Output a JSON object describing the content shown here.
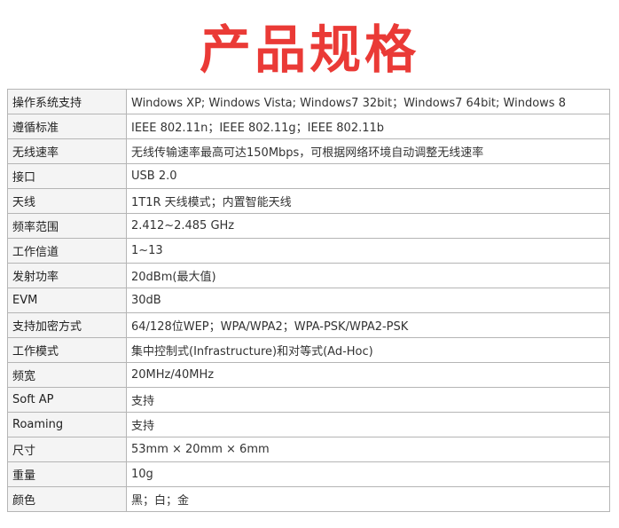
{
  "title": "产品规格",
  "colors": {
    "title": "#ea3a36",
    "border": "#b5b5b5",
    "label_bg": "#f4f4f4"
  },
  "specs": [
    {
      "label": "操作系统支持",
      "value": "Windows XP; Windows Vista; Windows7 32bit；Windows7 64bit; Windows 8"
    },
    {
      "label": "遵循标准",
      "value": "IEEE 802.11n；IEEE 802.11g；IEEE 802.11b"
    },
    {
      "label": "无线速率",
      "value": "无线传输速率最高可达150Mbps，可根据网络环境自动调整无线速率"
    },
    {
      "label": "接口",
      "value": "USB 2.0"
    },
    {
      "label": "天线",
      "value": "1T1R 天线模式；内置智能天线"
    },
    {
      "label": "频率范围",
      "value": "2.412~2.485 GHz"
    },
    {
      "label": "工作信道",
      "value": "1~13"
    },
    {
      "label": "发射功率",
      "value": "20dBm(最大值)"
    },
    {
      "label": "EVM",
      "value": "30dB"
    },
    {
      "label": "支持加密方式",
      "value": "64/128位WEP；WPA/WPA2；WPA-PSK/WPA2-PSK"
    },
    {
      "label": "工作模式",
      "value": "集中控制式(Infrastructure)和对等式(Ad-Hoc)"
    },
    {
      "label": "频宽",
      "value": "20MHz/40MHz"
    },
    {
      "label": "Soft AP",
      "value": "支持"
    },
    {
      "label": "Roaming",
      "value": "支持"
    },
    {
      "label": "尺寸",
      "value": "53mm × 20mm × 6mm"
    },
    {
      "label": "重量",
      "value": "10g"
    },
    {
      "label": "颜色",
      "value": "黑；白；金"
    }
  ]
}
